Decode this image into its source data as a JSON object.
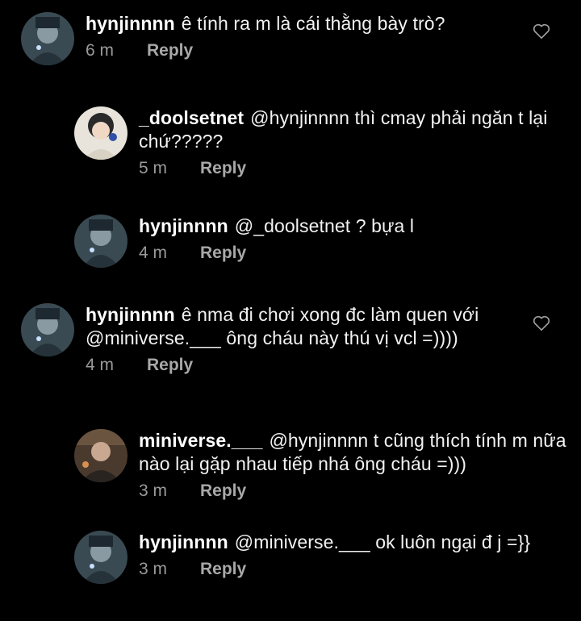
{
  "comments": [
    {
      "username": "hynjinnnn",
      "text": "ê tính ra m là cái thằng bày trò?",
      "time": "6 m",
      "reply_label": "Reply"
    },
    {
      "username": "_doolsetnet",
      "text": "@hynjinnnn thì cmay phải ngăn t lại chứ?????",
      "time": "5 m",
      "reply_label": "Reply"
    },
    {
      "username": "hynjinnnn",
      "text": "@_doolsetnet ? bựa l",
      "time": "4 m",
      "reply_label": "Reply"
    },
    {
      "username": "hynjinnnn",
      "text": "ê nma đi chơi xong đc làm quen với @miniverse.___ ông cháu này thú vị vcl =))))",
      "time": "4 m",
      "reply_label": "Reply"
    },
    {
      "username": "miniverse.___",
      "text": "@hynjinnnn t cũng thích tính m nữa nào lại gặp nhau tiếp nhá ông cháu =)))",
      "time": "3 m",
      "reply_label": "Reply"
    },
    {
      "username": "hynjinnnn",
      "text": "@miniverse.___ ok luôn ngại đ j =}}",
      "time": "3 m",
      "reply_label": "Reply"
    }
  ],
  "icons": {
    "like": "heart-outline-icon",
    "avatar": "profile-avatar"
  },
  "colors": {
    "background": "#000000",
    "text": "#f2f2f2",
    "meta": "#9a9a9a"
  }
}
